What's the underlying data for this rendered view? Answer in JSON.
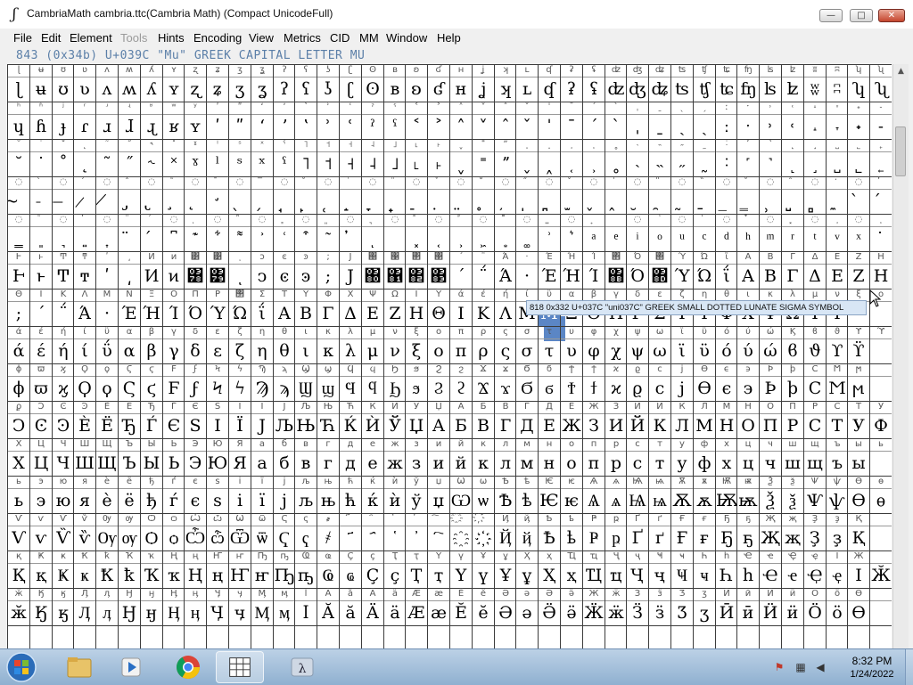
{
  "window": {
    "title": "CambriaMath  cambria.ttc(Cambria Math) (Compact UnicodeFull)",
    "app_icon_glyph": "ʃ",
    "minimize_glyph": "—",
    "maximize_glyph": "□",
    "close_glyph": "✕"
  },
  "menu": {
    "items": [
      "File",
      "Edit",
      "Element",
      "Tools",
      "Hints",
      "Encoding",
      "View",
      "Metrics",
      "CID",
      "MM",
      "Window",
      "Help"
    ],
    "disabled": [
      "Tools"
    ]
  },
  "info_line": "843  (0x34b)  U+039C  \"Mu\"  GREEK  CAPITAL  LETTER  MU",
  "tooltip": "818 0x332 U+037C \"uni037C\" GREEK SMALL DOTTED LUNATE SIGMA SYMBOL",
  "font_grid": {
    "rows": [
      {
        "labels": "ɭʉʊʋʌʍʎʏʐʑʒʓʔʕʖʗʘʙʚʛʜʝʞʟʠʡʢʣʤʥʦʧʨʩʪʫʬʭʮʯ",
        "glyphs": "ɭʉʊʋʌʍʎʏʐʑʒʓʔʕʖʗʘʙʚʛʜʝʞʟʠʡʢʣʤʥʦʧʨʩʪʫʬʭʮʯ"
      },
      {
        "labels": "ʰʱʲʳʴʵʶʷʸʹʺʻʼʽʾʿˀˁ˂˃˄˅ˆˇˈˉˊˋˌˍˎˏːˑ˒˓˔˕˖˗",
        "glyphs": "ɥɦɟɾɹɺɻʁʏʹʺʻʼʽʾʿˀˁ˂˃˄˅ˆˇˈˉˊˋˌˍˎˏːˑ˒˓˔˕˖˗"
      },
      {
        "labels": "˘˙˚˛˜˝˞˟ˠˡˢˣˤ˥˦˧˨˩˪˫ˬ˭ˮ˯˰˱˲˳˴˵˶˷˸˹˺˻˼˽˾˿",
        "glyphs": "˘˙˚˛˜˝˞˟ˠˡˢˣˤ˥˦˧˨˩˪˫ˬ˭ˮ˯˰˱˲˳˴˵˶˷˸˹˺˻˼˽˾˿"
      },
      {
        "labels": "◌̀◌́◌̂◌̃◌̄◌̅◌̆◌̇◌̈◌̉◌̊◌̋◌̌◌̍◌̎◌̏◌̐◌̑◌̒◌̓",
        "glyphs": "̴̵̶̷̸̡̢̧̨̛̖̗̘̙̜̝̞̟̠̣̤̥̦̩̪̫̬̭̮̯̰̱̲̳̹̺̻̼̀́̂̃̄̅̆̇̈̉̊̋̌̍̎̏̐̑̒̓̔̽̾̿̕̚"
      },
      {
        "labels": "◌͂◌̓◌̈́◌ͅ◌͆◌͇◌͈◌͉◌͊◌͋◌͌◌͍◌͎͏◌͐◌͑◌͒◌͓◌͔◌͕",
        "glyphs": "͇͈͉͍͎̈́͆͊͋͌͐͑͒͂̓ͅ͏͓͔͕͖͙͚͗͛ͣͤͥͦͧͨͩͪͫͬͭͮͯ͘͜͟͢͝͞͠͡"
      },
      {
        "labels": "ͰͱͲͳʹ͵Ͷͷ͸͹ͺͻͼͽ;Ϳ΀΁΂΃΄΅Ά·ΈΉΊ΋Ό΍ΎΏΐΑΒΓΔΕΖΗ",
        "glyphs": "ͰͱͲͳʹ͵Ͷͷ͸͹ͺͻͼͽ;Ϳ΀΁΂΃΄΅Ά·ΈΉΊ΋Ό΍ΎΏΐΑΒΓΔΕΖΗ"
      },
      {
        "labels": "ΘΙΚΛΜΝΞΟΠΡ΢ΣΤΥΦΧΨΩΪΫάέήίΰαβγδεζηθικλμνξο",
        "glyphs": ";΄΅Ά·ΈΉΊΌΎΏΐΑΒΓΔΕΖΗΘΙΚΛΜΝΞΟΠΡΣΤΥΦΧΨΩΪΫ"
      },
      {
        "labels": "άέήίΰαβγδεζηθικλμνξοπρςστυφχψωϊϋόύώϏϐϑϒϓϔ",
        "glyphs": "άέήίΰαβγδεζηθικλμνξοπρςστυφχψωϊϋόύώϐϑϒϔ"
      },
      {
        "labels": "ϕϖϗϘϙϚϛϜϝϞϟϠϡϢϣϤϥϦϧϨϩϪϫϬϭϮϯϰϱϲϳϴϵ϶ϷϸϹϺϻ",
        "glyphs": "ϕϖϗϘϙϚϛϜϝϞϟϠϡϢϣϤϥϦϧϨϩϪϫϬϭϮϯϰϱϲϳϴϵ϶ϷϸϹϺϻ"
      },
      {
        "labels": "ϼϽϾϿЀЁЂЃЄЅІЇЈЉЊЋЌЍЎЏАБВГДЕЖЗИЙКЛМНОПРСТУФ",
        "glyphs": "ϽϾϿЀЁЂЃЄЅІЇЈЉЊЋЌЍЎЏАБВГДЕЖЗИЙКЛМНОПРСТУФ"
      },
      {
        "labels": "ХЦЧШЩЪЫЬЭЮЯабвгдежзийклмнопрстуфхцчшщъыь",
        "glyphs": "ХЦЧШЩЪЫЬЭЮЯабвгдежзийклмнопрстуфхцчшщъы"
      },
      {
        "labels": "ьэюяѐёђѓєѕіїјљњћќѝўџѠѡѢѣѤѥѦѧѨѩѪѫѬѭѮѯѰѱѲѳ",
        "glyphs": "ьэюяѐёђѓєѕіїјљњћќѝўџѠѡѢѣѤѥѦѧѨѩѪѫѬѭѮѯѰѱѲѳ"
      },
      {
        "labels": "ѴѵѶѷѸѹѺѻѼѽѾѿҀҁ҂҃҄҅҆҇҈҉ҊҋҌҍҎҏҐґҒғҔҕҖҗҘҙҚ",
        "glyphs": "ѴѵѶѷѸѹѺѻѼѽѾѿҀҁ҂҃҄҅҆҇҈҉ҊҋҌҍҎҏҐґҒғҔҕҖҗҘҙҚ"
      },
      {
        "labels": "қҜҝҞҟҠҡҢңҤҥҦҧҨҩҪҫҬҭҮүҰұҲҳҴҵҶҷҸҹҺһҼҽҾҿӀӁ",
        "glyphs": "ҚқҜҝҞҟҠҡҢңҤҥҦҧҨҩҪҫҬҭҮүҰұҲҳҴҵҶҷҸҹҺһҼҽҾҿӀӁ"
      },
      {
        "labels": "ӂӃӄӅӆӇӈӉӊӋӌӍӎӏӐӑӒӓӔӕӖӗӘәӚӛӜӝӞӟӠӡӢӣӤӥӦӧӨ",
        "glyphs": "ӂӃӄӅӆӇӈӉӊӋӌӍӎӏӐӑӒӓӔӕӖӗӘәӚӛӜӝӞӟӠӡӢӣӤӥӦӧӨ"
      }
    ],
    "selected_glyph": "Μ",
    "selected_label": "Μ",
    "columns": 40
  },
  "taskbar": {
    "time": "8:32 PM",
    "date": "1/24/2022",
    "apps": [
      "file-explorer",
      "media-player",
      "chrome",
      "fontforge",
      "app-lambda"
    ]
  }
}
